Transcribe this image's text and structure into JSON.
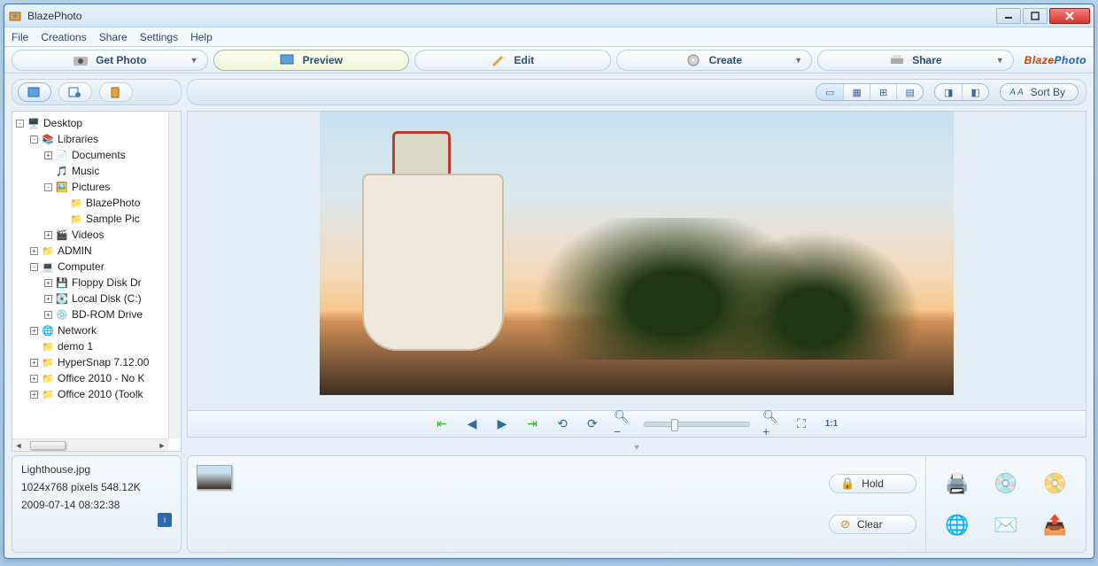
{
  "window": {
    "title": "BlazePhoto",
    "logo_part1": "Blaze",
    "logo_part2": "Photo"
  },
  "menubar": [
    "File",
    "Creations",
    "Share",
    "Settings",
    "Help"
  ],
  "toolbar": [
    {
      "label": "Get Photo",
      "icon": "camera-icon",
      "dropdown": true
    },
    {
      "label": "Preview",
      "icon": "monitor-icon",
      "active": true
    },
    {
      "label": "Edit",
      "icon": "brush-icon"
    },
    {
      "label": "Create",
      "icon": "disc-icon",
      "dropdown": true
    },
    {
      "label": "Share",
      "icon": "printer-icon",
      "dropdown": true
    }
  ],
  "left_tabs": [
    "folder-tree-tab",
    "recent-tab",
    "tags-tab"
  ],
  "tree": [
    {
      "depth": 0,
      "exp": "-",
      "icon": "🖥️",
      "label": "Desktop"
    },
    {
      "depth": 1,
      "exp": "-",
      "icon": "📚",
      "label": "Libraries"
    },
    {
      "depth": 2,
      "exp": "+",
      "icon": "📄",
      "label": "Documents"
    },
    {
      "depth": 2,
      "exp": "",
      "icon": "🎵",
      "label": "Music"
    },
    {
      "depth": 2,
      "exp": "-",
      "icon": "🖼️",
      "label": "Pictures"
    },
    {
      "depth": 3,
      "exp": "",
      "icon": "📁",
      "label": "BlazePhoto"
    },
    {
      "depth": 3,
      "exp": "",
      "icon": "📁",
      "label": "Sample Pic"
    },
    {
      "depth": 2,
      "exp": "+",
      "icon": "🎬",
      "label": "Videos"
    },
    {
      "depth": 1,
      "exp": "+",
      "icon": "📁",
      "label": "ADMIN"
    },
    {
      "depth": 1,
      "exp": "-",
      "icon": "💻",
      "label": "Computer"
    },
    {
      "depth": 2,
      "exp": "+",
      "icon": "💾",
      "label": "Floppy Disk Dr"
    },
    {
      "depth": 2,
      "exp": "+",
      "icon": "💽",
      "label": "Local Disk (C:)"
    },
    {
      "depth": 2,
      "exp": "+",
      "icon": "💿",
      "label": "BD-ROM Drive"
    },
    {
      "depth": 1,
      "exp": "+",
      "icon": "🌐",
      "label": "Network"
    },
    {
      "depth": 1,
      "exp": "",
      "icon": "📁",
      "label": "demo 1"
    },
    {
      "depth": 1,
      "exp": "+",
      "icon": "📁",
      "label": "HyperSnap 7.12.00"
    },
    {
      "depth": 1,
      "exp": "+",
      "icon": "📁",
      "label": "Office 2010 - No K"
    },
    {
      "depth": 1,
      "exp": "+",
      "icon": "📁",
      "label": "Office 2010 (Toolk"
    }
  ],
  "view_modes": [
    "single-view",
    "grid-2x2",
    "grid-3x3",
    "filmstrip"
  ],
  "secondary_modes": [
    "compare-left",
    "compare-right"
  ],
  "sort": {
    "label": "Sort By",
    "icon_text": "A A"
  },
  "preview_controls": [
    "first-image",
    "prev-image",
    "next-image",
    "last-image",
    "rotate-left",
    "rotate-right",
    "zoom-out",
    "zoom-slider",
    "zoom-in",
    "fit-window",
    "actual-size"
  ],
  "info": {
    "filename": "Lighthouse.jpg",
    "dimensions": "1024x768 pixels  548.12K",
    "datetime": "2009-07-14 08:32:38"
  },
  "tray": {
    "hold_label": "Hold",
    "clear_label": "Clear"
  },
  "actions": [
    "print",
    "burn-cd",
    "burn-dvd",
    "html-web",
    "email",
    "export"
  ]
}
